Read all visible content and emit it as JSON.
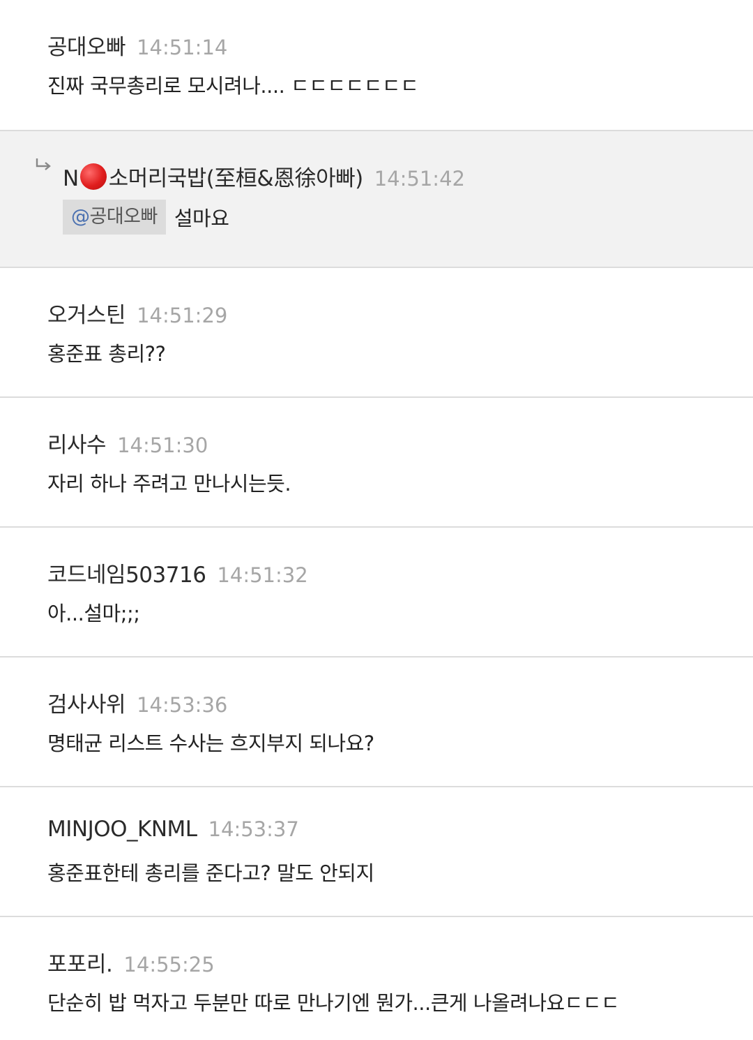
{
  "comments": [
    {
      "author": "공대오빠",
      "time": "14:51:14",
      "text": "진짜 국무총리로 모시려나.... ㄷㄷㄷㄷㄷㄷㄷ"
    },
    {
      "author_prefix": "N",
      "author": "소머리국밥(至桓&恩徐아빠)",
      "time": "14:51:42",
      "mention_at": "@",
      "mention_name": "공대오빠",
      "text": "설마요",
      "is_reply": true
    },
    {
      "author": "오거스틴",
      "time": "14:51:29",
      "text": "홍준표 총리??"
    },
    {
      "author": "리사수",
      "time": "14:51:30",
      "text": "자리 하나 주려고 만나시는듯."
    },
    {
      "author": "코드네임503716",
      "time": "14:51:32",
      "text": "아...설마;;;"
    },
    {
      "author": "검사사위",
      "time": "14:53:36",
      "text": "명태균 리스트 수사는 흐지부지 되나요?"
    },
    {
      "author": "MINJOO_KNML",
      "time": "14:53:37",
      "text": "홍준표한테 총리를 준다고? 말도 안되지"
    },
    {
      "author": "포포리.",
      "time": "14:55:25",
      "text": "단순히 밥 먹자고 두분만 따로 만나기엔 뭔가...큰게 나올려나요ㄷㄷㄷ"
    }
  ],
  "icons": {
    "reply": "reply-arrow-icon",
    "status": "red-circle-icon"
  },
  "colors": {
    "reply_background": "#f2f2f2",
    "divider": "#dcdcdc",
    "timestamp": "#a6a6a6",
    "mention_chip": "#dcdcdc",
    "red_dot": "#e01e1e"
  }
}
